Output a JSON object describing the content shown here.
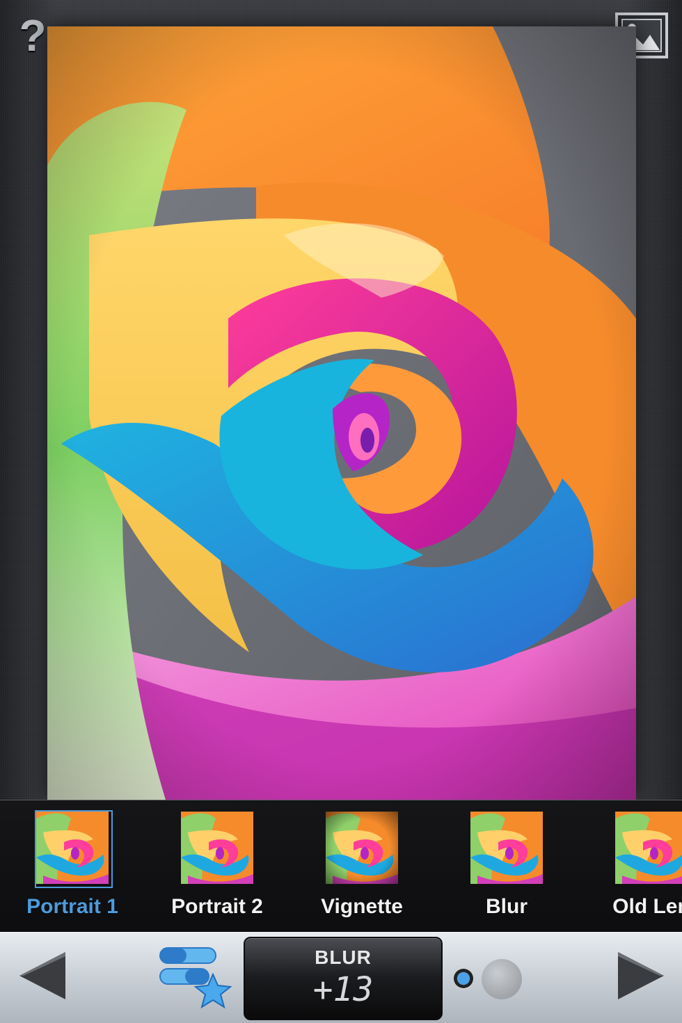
{
  "editor": {
    "help_label": "?",
    "icons": {
      "help": "question-mark-icon",
      "gallery": "image-gallery-icon"
    }
  },
  "filters": [
    {
      "label": "Portrait 1",
      "selected": true
    },
    {
      "label": "Portrait 2",
      "selected": false
    },
    {
      "label": "Vignette",
      "selected": false
    },
    {
      "label": "Blur",
      "selected": false
    },
    {
      "label": "Old Len",
      "selected": false
    }
  ],
  "toolbar": {
    "value_label": "BLUR",
    "value_number": "+13",
    "icons": {
      "prev": "triangle-left-icon",
      "styles": "styles-star-icon",
      "next": "triangle-right-icon"
    },
    "page": {
      "active_index": 0,
      "count": 2
    }
  },
  "colors": {
    "accent": "#4d9bdc",
    "strip_background": "#141416",
    "toolbar_background": "#c9cfd6"
  }
}
